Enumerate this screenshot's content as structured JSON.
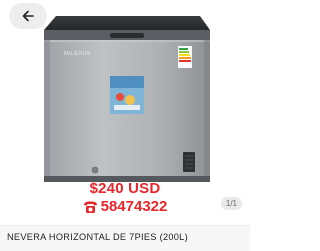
{
  "listing": {
    "price": "$240 USD",
    "phone": "58474322",
    "title": "NEVERA HORIZONTAL DE 7PIES (200L)"
  },
  "gallery": {
    "counter": "1/1",
    "brand_mark": "MILEXUS"
  },
  "icons": {
    "back": "arrow-left-icon",
    "phone": "telephone-icon"
  },
  "colors": {
    "price": "#e8262b",
    "body_steel": "#a9acb0",
    "lid_dark": "#2d2f33"
  }
}
